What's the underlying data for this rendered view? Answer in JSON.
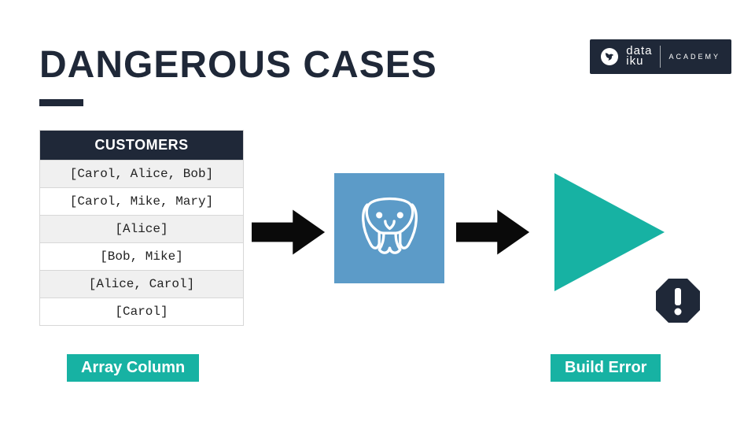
{
  "logo": {
    "brand_top": "data",
    "brand_bottom": "iku",
    "sub": "ACADEMY"
  },
  "title": "DANGEROUS CASES",
  "table": {
    "header": "CUSTOMERS",
    "rows": [
      "[Carol, Alice, Bob]",
      "[Carol, Mike, Mary]",
      "[Alice]",
      "[Bob, Mike]",
      "[Alice, Carol]",
      "[Carol]"
    ]
  },
  "labels": {
    "array": "Array Column",
    "build_error": "Build Error"
  },
  "icons": {
    "center": "postgresql-icon",
    "right": "play-icon",
    "error": "warning-octagon-icon",
    "logo_mark": "bird-icon",
    "arrow": "right-arrow-icon"
  },
  "colors": {
    "dark": "#1f2838",
    "teal": "#17b2a3",
    "pg_blue": "#5c9bc8"
  }
}
